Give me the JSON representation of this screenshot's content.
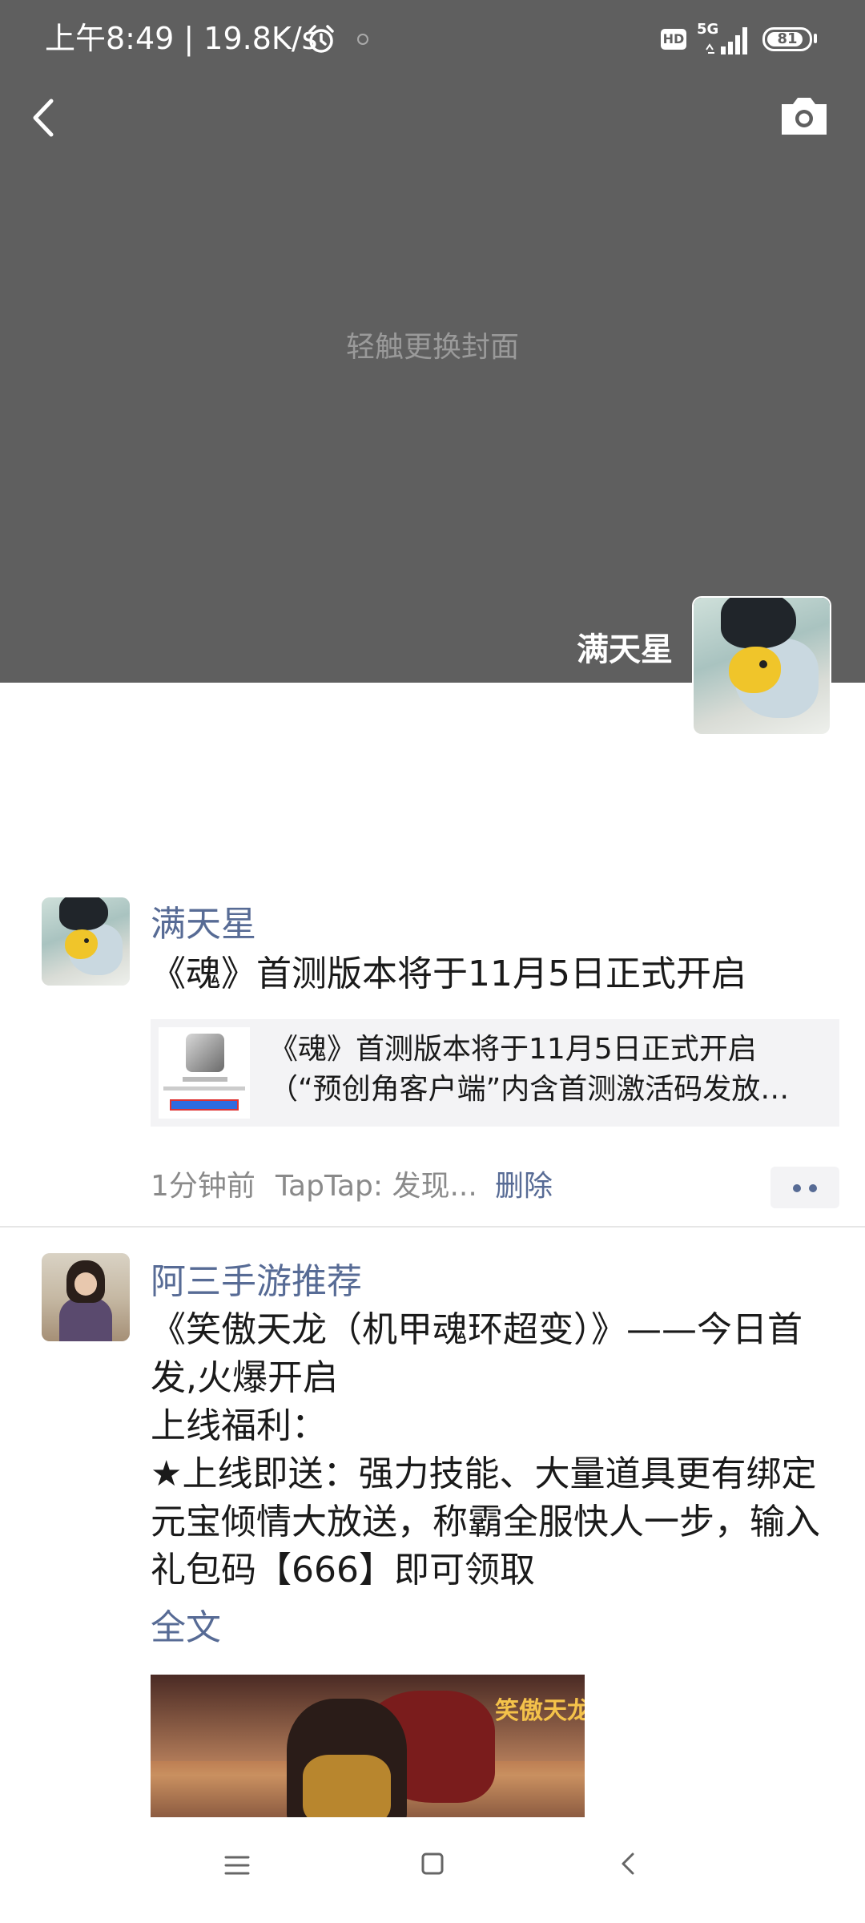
{
  "status_bar": {
    "time_speed": "上午8:49 | 19.8K/s",
    "network": "5G",
    "hd": "HD",
    "battery": "81",
    "icons": [
      "alarm-icon",
      "hd-icon",
      "signal-icon",
      "battery-icon"
    ]
  },
  "cover": {
    "hint": "轻触更换封面",
    "owner_name": "满天星",
    "icons": [
      "back-arrow-icon",
      "camera-icon"
    ]
  },
  "posts": [
    {
      "author": "满天星",
      "text": "《魂》首测版本将于11月5日正式开启",
      "link": {
        "title_line1": "《魂》首测版本将于11月5日正式开启",
        "title_line2": "（“预创角客户端”内含首测激活码发放…"
      },
      "time": "1分钟前",
      "source": "TapTap: 发现...",
      "delete": "删除"
    },
    {
      "author": "阿三手游推荐",
      "text": "《笑傲天龙（机甲魂环超变）》——今日首发,火爆开启\n上线福利：\n★上线即送：强力技能、大量道具更有绑定元宝倾情大放送，称霸全服快人一步，输入礼包码【666】即可领取",
      "full_text": "全文",
      "image_logo": "笑傲天龙"
    }
  ],
  "navbar": {
    "icons": [
      "menu-icon",
      "home-icon",
      "back-icon"
    ]
  },
  "colors": {
    "cover_bg": "#5f5f5f",
    "link_blue": "#576b95",
    "text": "#1a1a1a",
    "meta_gray": "#8a8a8a"
  }
}
